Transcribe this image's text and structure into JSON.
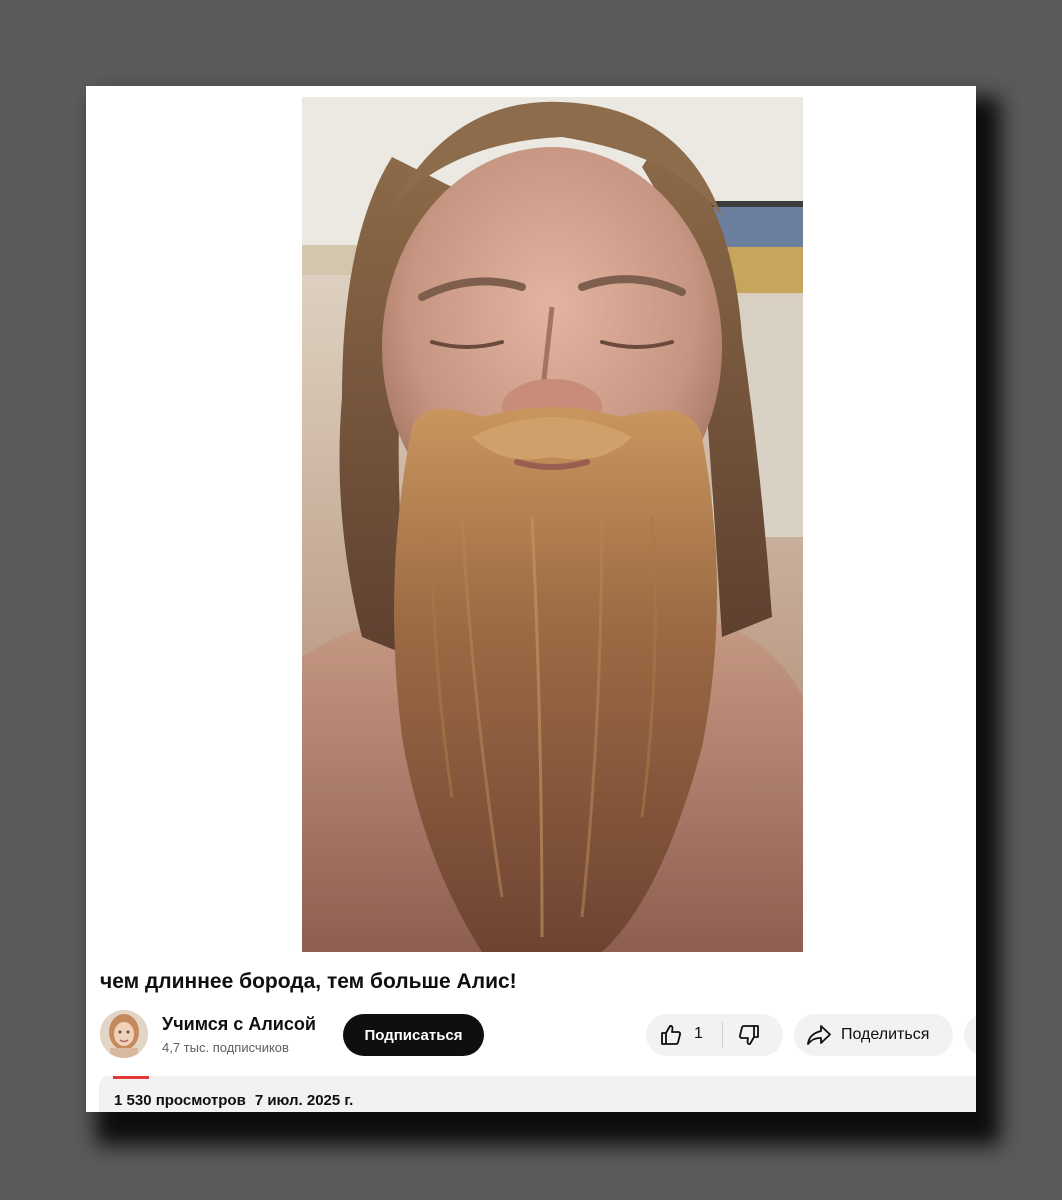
{
  "video": {
    "title": "чем длиннее борода, тем больше Алис!"
  },
  "channel": {
    "name": "Учимся с Алисой",
    "subscribers": "4,7 тыс. подписчиков",
    "subscribe_label": "Подписаться"
  },
  "actions": {
    "like_count": "1",
    "share_label": "Поделиться"
  },
  "description": {
    "views": "1 530 просмотров",
    "date": "7 июл. 2025 г."
  },
  "colors": {
    "page_background": "#5a5a5a",
    "card_background": "#ffffff",
    "subscribe_button": "#0f0f0f",
    "chip_background": "#f2f2f2",
    "accent": "#e53935"
  }
}
